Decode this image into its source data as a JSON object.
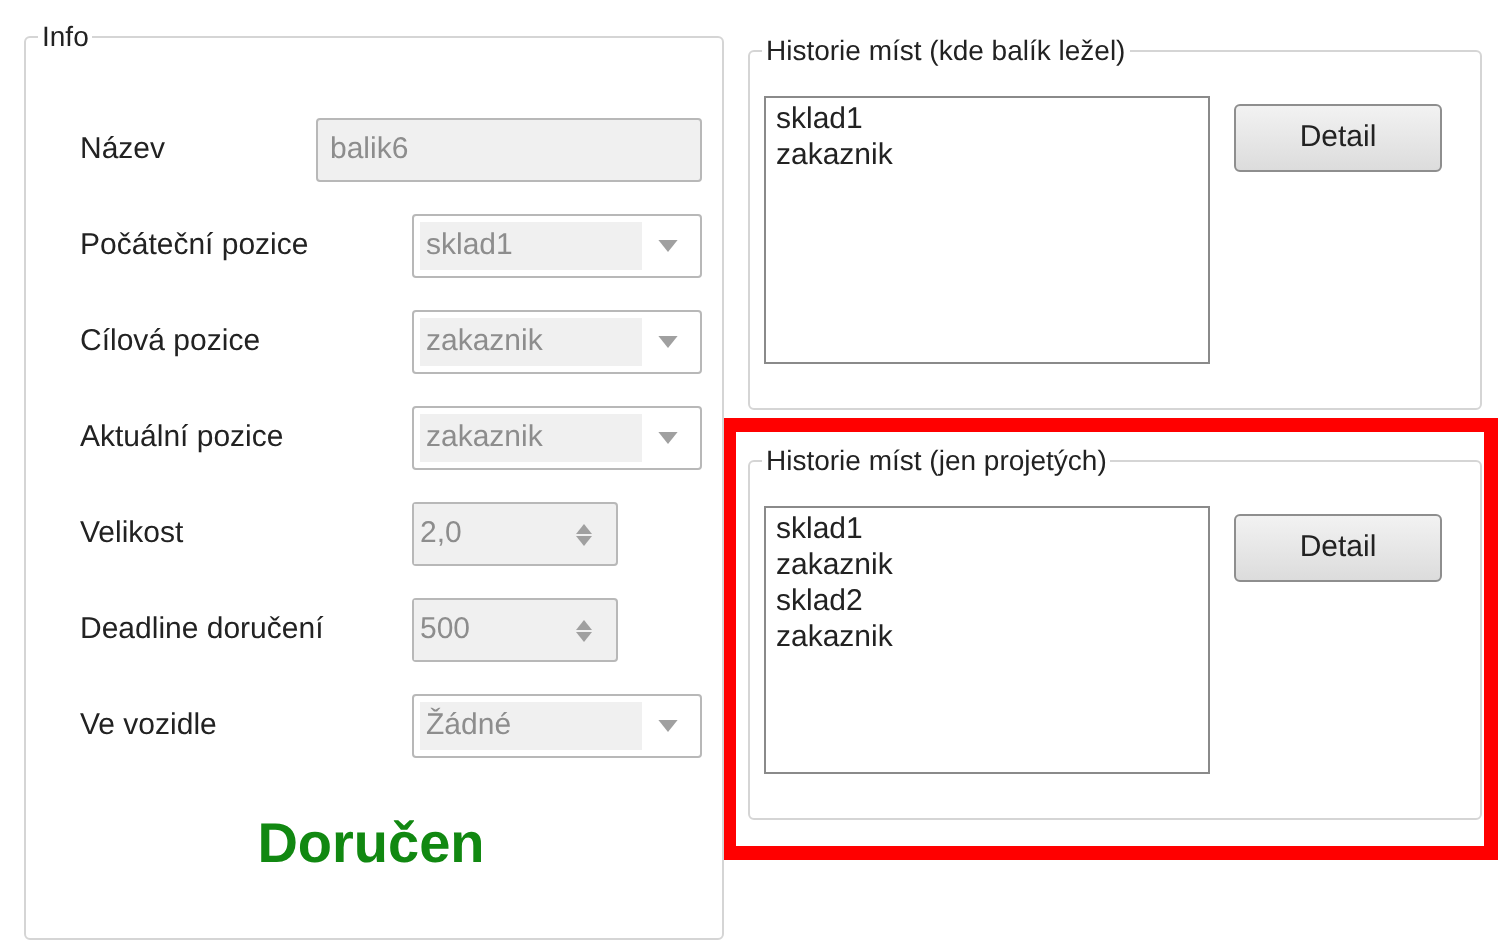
{
  "info": {
    "title": "Info",
    "fields": [
      {
        "kind": "text",
        "label": "Název",
        "value": "balik6",
        "disabled": true
      },
      {
        "kind": "combo",
        "label": "Počáteční pozice",
        "value": "sklad1",
        "disabled": true
      },
      {
        "kind": "combo",
        "label": "Cílová pozice",
        "value": "zakaznik",
        "disabled": true
      },
      {
        "kind": "combo",
        "label": "Aktuální pozice",
        "value": "zakaznik",
        "disabled": true
      },
      {
        "kind": "spinner",
        "label": "Velikost",
        "value": "2,0",
        "disabled": true
      },
      {
        "kind": "spinner",
        "label": "Deadline doručení",
        "value": "500",
        "disabled": true
      },
      {
        "kind": "combo",
        "label": "Ve vozidle",
        "value": "Žádné",
        "disabled": true
      }
    ],
    "status": "Doručen"
  },
  "history_groups": [
    {
      "title": "Historie míst (kde balík ležel)",
      "items": [
        "sklad1",
        "zakaznik"
      ],
      "button": "Detail",
      "highlighted": false
    },
    {
      "title": "Historie míst (jen projetých)",
      "items": [
        "sklad1",
        "zakaznik",
        "sklad2",
        "zakaznik"
      ],
      "button": "Detail",
      "highlighted": true
    }
  ]
}
